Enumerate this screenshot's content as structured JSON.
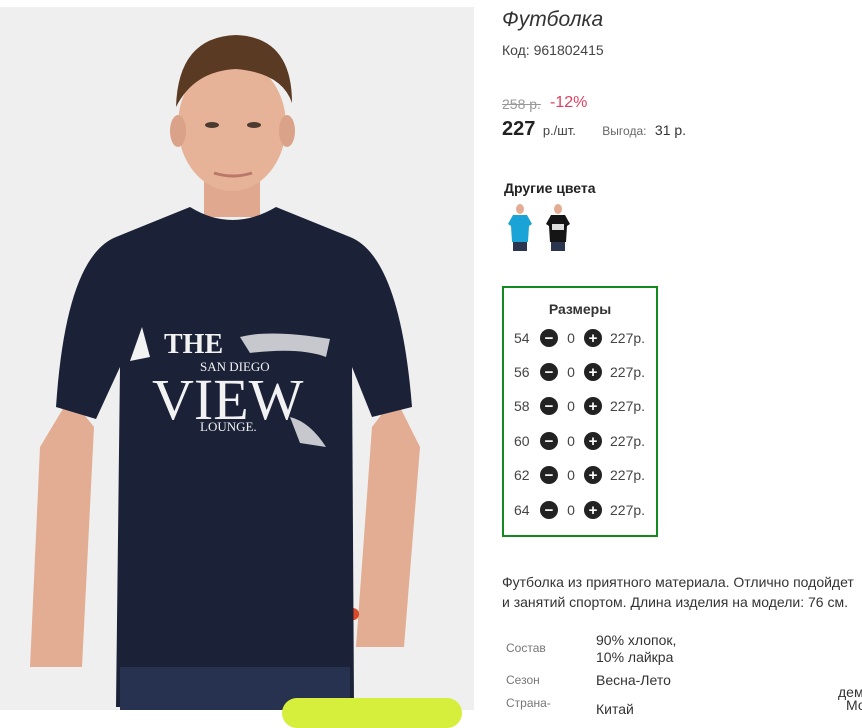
{
  "product": {
    "title": "Футболка",
    "code": "Код: 961802415",
    "old_price": "258 р.",
    "discount": "-12%",
    "price": "227",
    "unit": "р./шт.",
    "savings_label": "Выгода:",
    "savings_value": "31 р."
  },
  "colors": {
    "title": "Другие цвета",
    "items": [
      {
        "name": "blue-tshirt",
        "color": "#1aa3d6"
      },
      {
        "name": "black-tshirt",
        "color": "#151515"
      }
    ]
  },
  "sizes": {
    "title": "Размеры",
    "rows": [
      {
        "size": "54",
        "qty": "0",
        "price": "227р."
      },
      {
        "size": "56",
        "qty": "0",
        "price": "227р."
      },
      {
        "size": "58",
        "qty": "0",
        "price": "227р."
      },
      {
        "size": "60",
        "qty": "0",
        "price": "227р."
      },
      {
        "size": "62",
        "qty": "0",
        "price": "227р."
      },
      {
        "size": "64",
        "qty": "0",
        "price": "227р."
      }
    ]
  },
  "description": {
    "line1": "Футболка из приятного материала. Отлично подойдет",
    "line2": "и занятий спортом. Длина изделия на модели: 76 см."
  },
  "specs": {
    "composition_label": "Состав",
    "composition_line1": "90% хлопок,",
    "composition_line2": "10% лайкра",
    "season_label": "Сезон",
    "season_value": "Весна-Лето",
    "country_label": "Страна-",
    "country_value": "Китай",
    "cut_right_1": "дем",
    "cut_right_2": "Мо"
  },
  "photo": {
    "print_text_big": "VIEW",
    "print_text_the": "THE",
    "print_text_sub": "SAN DIEGO",
    "print_text_lounge": "LOUNGE.",
    "shirt_color": "#1b2238"
  },
  "colors_theme": {
    "accent_red": "#e0405e",
    "sizes_border": "#138a1e",
    "cta_green": "#d6ef3d"
  }
}
